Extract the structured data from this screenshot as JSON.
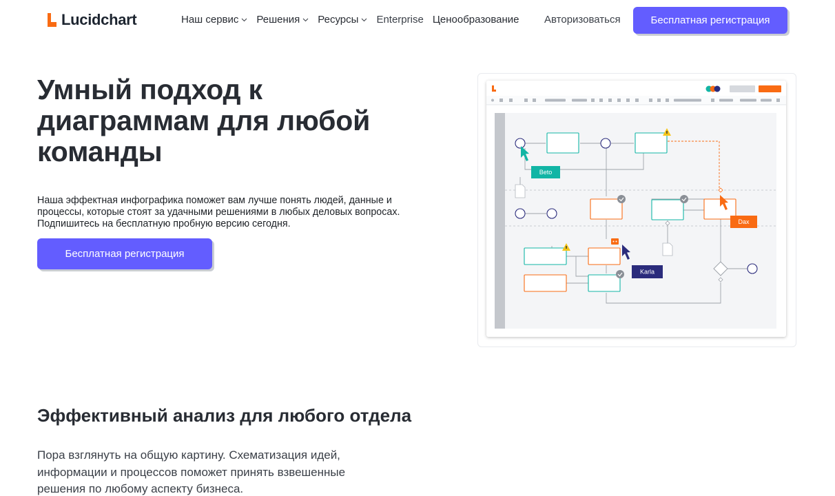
{
  "brand": {
    "name": "Lucidchart",
    "logo_color": "#f96b13"
  },
  "nav": {
    "items": [
      {
        "label": "Наш сервис",
        "dropdown": true
      },
      {
        "label": "Решения",
        "dropdown": true
      },
      {
        "label": "Ресурсы",
        "dropdown": true
      },
      {
        "label": "Enterprise",
        "dropdown": false
      },
      {
        "label": "Ценообразование",
        "dropdown": false
      }
    ],
    "login": "Авторизоваться",
    "signup": "Бесплатная регистрация"
  },
  "hero": {
    "title": "Умный подход к диаграммам для любой команды",
    "subtitle": "Наша эффектная инфографика поможет вам лучше понять людей, данные и процессы, которые стоят за удачными решениями в любых деловых вопросах. Подпишитесь на бесплатную пробную версию сегодня.",
    "cta": "Бесплатная регистрация"
  },
  "diagram": {
    "cursors": [
      {
        "name": "Beto",
        "color": "#12b5a5"
      },
      {
        "name": "Dax",
        "color": "#f96b13"
      },
      {
        "name": "Karla",
        "color": "#2b2c7c"
      }
    ],
    "accent_color": "#635dff"
  },
  "section": {
    "title": "Эффективный анализ для любого отдела",
    "body": "Пора взглянуть на общую картину. Схематизация идей, информации и процессов поможет принять взвешенные решения по любому аспекту бизнеса."
  }
}
